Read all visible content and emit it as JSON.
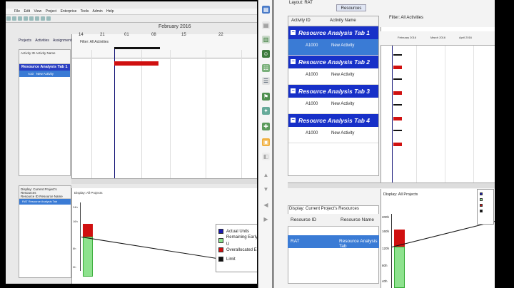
{
  "left": {
    "menus": [
      "File",
      "Edit",
      "View",
      "Project",
      "Enterprise",
      "Tools",
      "Admin",
      "Help"
    ],
    "project_label": "Projects   Activities   Assignments",
    "tabs": [
      "Projects",
      "Activities",
      "Assignments"
    ],
    "grid_header": "Activity ID    Activity Name",
    "group_label": "Resource Analysis Tab 1",
    "row": {
      "id": "A10",
      "name": "New Activity"
    },
    "gantt_filter": "Filter: All Activities",
    "month": "February 2016",
    "days": [
      "14",
      "21",
      "01",
      "08",
      "15",
      "22"
    ],
    "bottom_header": "Display: Current Project's Resources",
    "bottom_cols": "Resource ID    Resource Name",
    "bottom_sel": "RAT    Resource Analysis Tab",
    "chart_display": "Display: All Projects",
    "chart_ylabels": [
      "24h",
      "16h",
      "8h",
      "0h"
    ],
    "legend": [
      {
        "label": "Actual Units",
        "color": "#1a1ab0"
      },
      {
        "label": "Remaining Early U",
        "color": "#8ee28e"
      },
      {
        "label": "Overallocated Ear",
        "color": "#d01010"
      },
      {
        "label": "Limit",
        "color": "#111111"
      }
    ]
  },
  "right": {
    "layout": "Layout: RAT",
    "col_activity_id": "Activity ID",
    "col_activity_name": "Activity Name",
    "tab_resources": "Resources",
    "groups": [
      {
        "label": "Resource Analysis Tab 1",
        "id": "A1000",
        "name": "New Activity",
        "selected": true
      },
      {
        "label": "Resource Analysis Tab 2",
        "id": "A1000",
        "name": "New Activity",
        "selected": false
      },
      {
        "label": "Resource Analysis Tab 3",
        "id": "A1000",
        "name": "New Activity",
        "selected": false
      },
      {
        "label": "Resource Analysis Tab 4",
        "id": "A1000",
        "name": "New Activity",
        "selected": false
      }
    ],
    "filter": "Filter: All Activities",
    "months": [
      "February 2016",
      "March 2016",
      "April 2016"
    ],
    "res_display": "Display: Current Project's Resources",
    "res_col_id": "Resource ID",
    "res_col_name": "Resource Name",
    "res_sel_id": "RAT",
    "res_sel_name": "Resource Analysis Tab",
    "chart_display": "Display: All Projects",
    "chart_ylabels": [
      "200h",
      "160h",
      "120h",
      "80h",
      "40h"
    ]
  }
}
